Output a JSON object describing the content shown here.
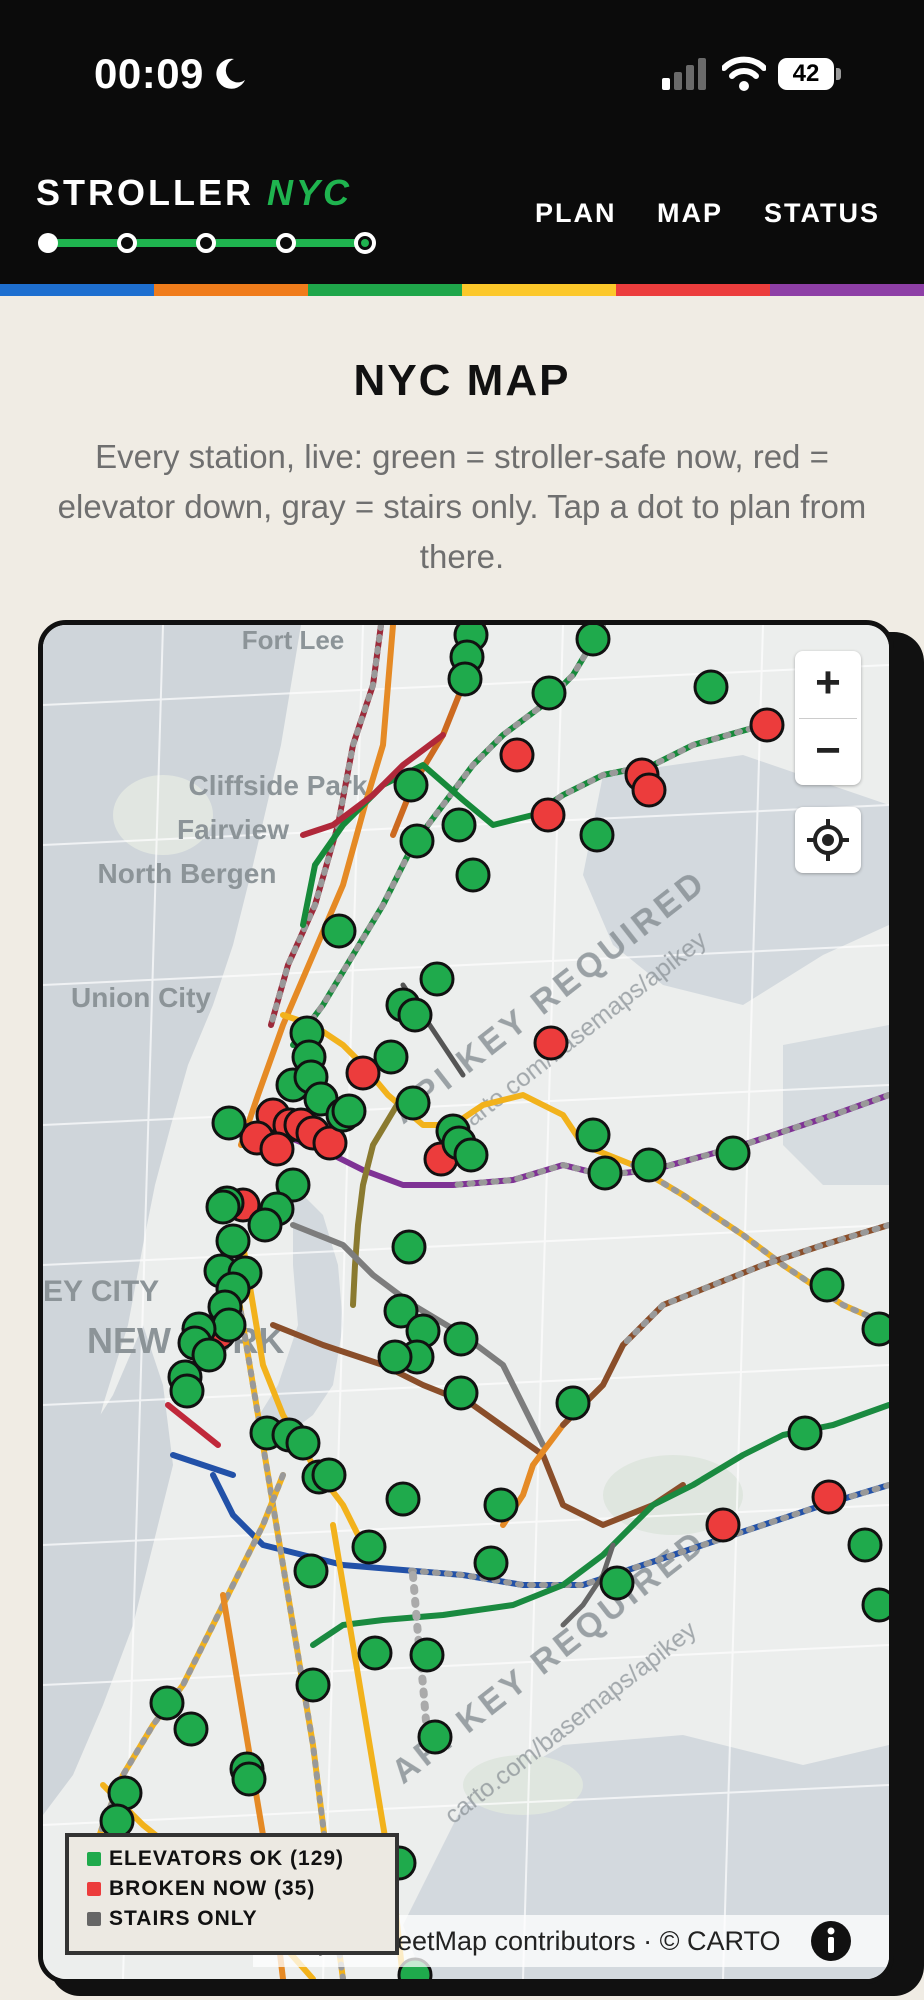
{
  "status_bar": {
    "time": "00:09",
    "battery": "42"
  },
  "header": {
    "brand_main": "STROLLER",
    "brand_accent": "NYC",
    "nav": [
      "PLAN",
      "MAP",
      "STATUS"
    ]
  },
  "colors": {
    "ok": "#1faa4c",
    "broken": "#ec3c3c",
    "stairs": "#666666",
    "rainbow": [
      "#1e6fd0",
      "#f07c1b",
      "#1fa64a",
      "#fcc82a",
      "#ec3d3d",
      "#8e3fa6"
    ]
  },
  "page": {
    "title": "NYC MAP",
    "description": "Every station, live: green = stroller-safe now, red = elevator down, gray = stairs only. Tap a dot to plan from there."
  },
  "map": {
    "place_labels": [
      "Fort Lee",
      "Cliffside Park",
      "Fairview",
      "North Bergen",
      "Union City",
      "EY CITY",
      "NEW YORK"
    ],
    "watermark_main": "API KEY REQUIRED",
    "watermark_sub": "carto.com/basemaps/apikey",
    "zoom_in": "+",
    "zoom_out": "−",
    "locate_icon": "crosshair-icon",
    "attribution": "© OpenStreetMap contributors · © CARTO",
    "info_icon": "info-icon",
    "legend": {
      "ok": "ELEVATORS OK (129)",
      "broken": "BROKEN NOW (35)",
      "stairs": "STAIRS ONLY"
    }
  }
}
